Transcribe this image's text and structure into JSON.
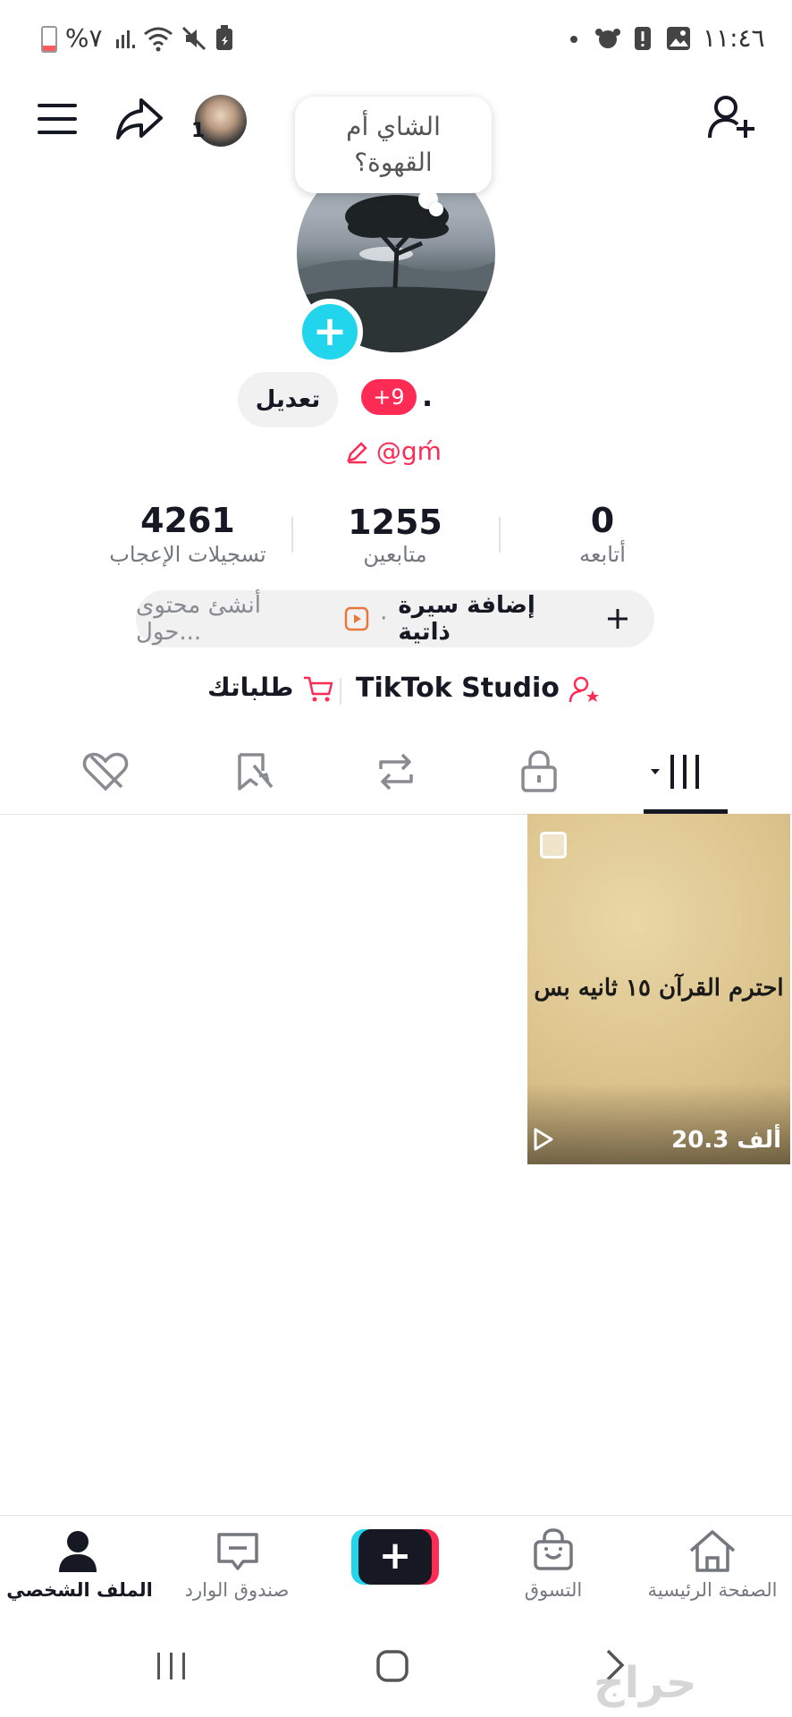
{
  "status_bar": {
    "time": "١١:٤٦",
    "battery": "%٧",
    "colors": {
      "battery_low": "#fe5c5c"
    }
  },
  "header": {
    "following_count_badge": "1",
    "icons": [
      "menu-icon",
      "share-icon",
      "add-friend-icon"
    ]
  },
  "profile": {
    "bubble_text": "الشاي أم القهوة؟",
    "edit_label": "تعديل",
    "notification_badge": "+9",
    "display_name": ".",
    "username": "@gḿ"
  },
  "stats": [
    {
      "value": "4261",
      "label": "تسجيلات الإعجاب"
    },
    {
      "value": "1255",
      "label": "متابعين"
    },
    {
      "value": "0",
      "label": "أتابعه"
    }
  ],
  "bio": {
    "add_label": "إضافة سيرة ذاتية",
    "separator": "·",
    "create_hint": "أنشئ محتوى حول..."
  },
  "links": {
    "studio": "TikTok Studio",
    "orders": "طلباتك"
  },
  "tabs": [
    "videos-tab",
    "private-tab",
    "reposts-tab",
    "favorites-tab",
    "liked-tab"
  ],
  "videos": [
    {
      "caption": "احترم القرآن ١٥ ثانيه بس",
      "views": "20.3 ألف"
    }
  ],
  "bottom_nav": [
    {
      "label": "الملف الشخصي"
    },
    {
      "label": "صندوق الوارد"
    },
    {
      "label": ""
    },
    {
      "label": "التسوق"
    },
    {
      "label": "الصفحة الرئيسية"
    }
  ],
  "watermark": "حراج",
  "colors": {
    "accent": "#fe2c55",
    "cyan": "#20d5ec",
    "text": "#161823",
    "muted": "#75777f",
    "chip_bg": "#f1f1f2"
  }
}
